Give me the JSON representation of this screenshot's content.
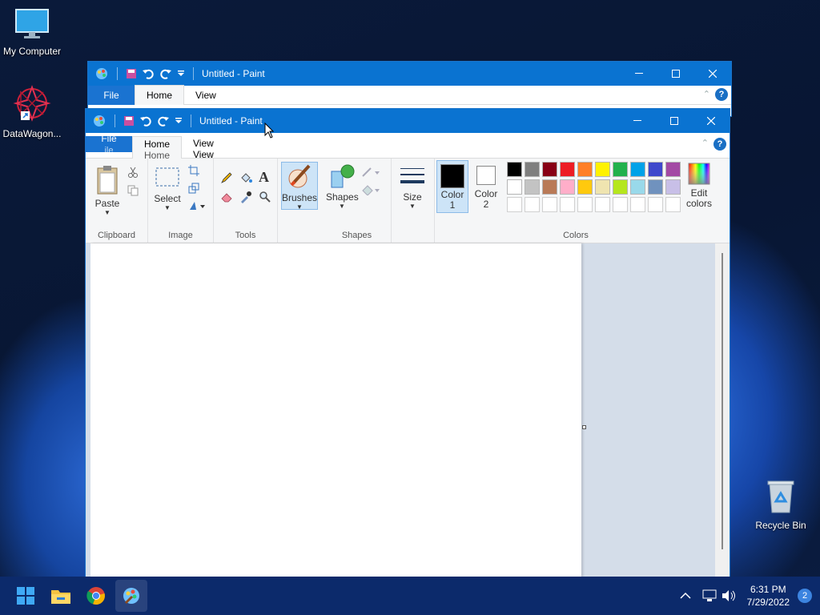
{
  "desktop": {
    "icons": [
      {
        "label": "My Computer"
      },
      {
        "label": "DataWagon..."
      },
      {
        "label": "Recycle Bin"
      }
    ]
  },
  "back_window": {
    "title": "Untitled - Paint",
    "tabs": [
      "File",
      "Home",
      "View"
    ]
  },
  "front_window": {
    "title": "Untitled - Paint",
    "tabs": [
      "File",
      "Home",
      "View"
    ],
    "ghost_tabs": [
      "ile",
      "Home",
      "View"
    ],
    "help": "?",
    "ribbon": {
      "clipboard": {
        "label": "Clipboard",
        "paste": "Paste"
      },
      "image": {
        "label": "Image",
        "select": "Select"
      },
      "tools": {
        "label": "Tools"
      },
      "brushes": {
        "label": "Brushes"
      },
      "shapes": {
        "label": "Shapes",
        "button": "Shapes"
      },
      "size": {
        "label": "Size"
      },
      "color1": {
        "line1": "Color",
        "line2": "1"
      },
      "color2": {
        "line1": "Color",
        "line2": "2"
      },
      "colors": {
        "label": "Colors",
        "edit_line1": "Edit",
        "edit_line2": "colors",
        "row1": [
          "#000000",
          "#7f7f7f",
          "#880015",
          "#ed1c24",
          "#ff7f27",
          "#fff200",
          "#22b14c",
          "#00a2e8",
          "#3f48cc",
          "#a349a4"
        ],
        "row2": [
          "#ffffff",
          "#c3c3c3",
          "#b97a57",
          "#ffaec9",
          "#ffc90e",
          "#efe4b0",
          "#b5e61d",
          "#99d9ea",
          "#7092be",
          "#c8bfe7"
        ]
      }
    }
  },
  "taskbar": {
    "time": "6:31 PM",
    "date": "7/29/2022",
    "notifications": "2"
  }
}
